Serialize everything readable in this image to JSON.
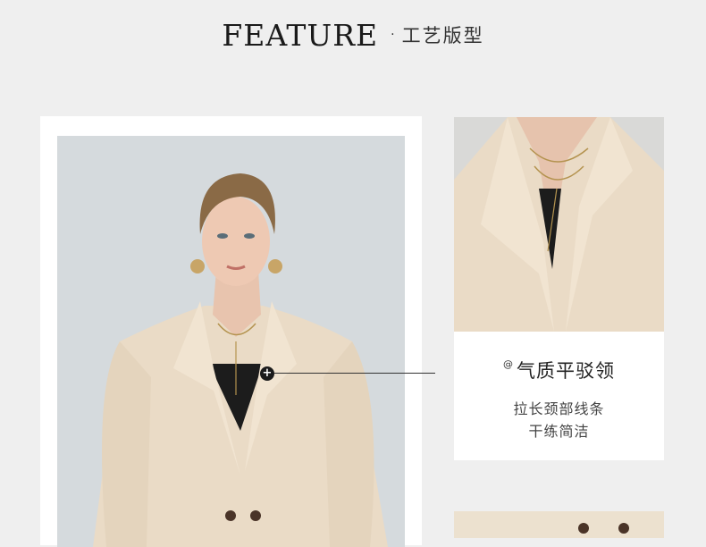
{
  "header": {
    "title_en": "FEATURE",
    "separator": "·",
    "title_cn": "工艺版型"
  },
  "feature": {
    "marker_symbol": "+",
    "caption": {
      "icon_symbol": "@",
      "title": "气质平驳领",
      "line1": "拉长颈部线条",
      "line2": "干练简洁"
    }
  }
}
